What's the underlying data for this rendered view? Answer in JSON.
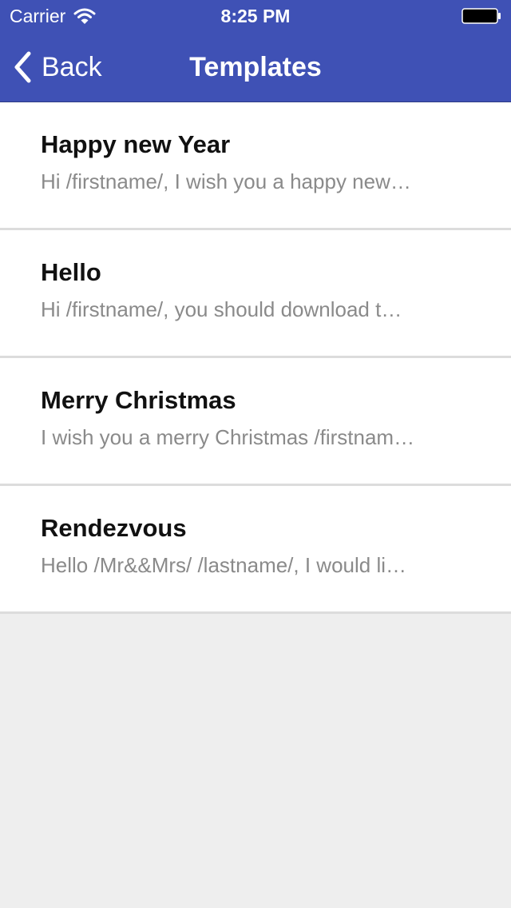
{
  "status_bar": {
    "carrier": "Carrier",
    "time": "8:25 PM",
    "wifi_icon": "wifi-icon",
    "battery_icon": "battery-icon"
  },
  "nav": {
    "back_label": "Back",
    "back_icon": "chevron-left-icon",
    "title": "Templates"
  },
  "colors": {
    "header_bg": "#3f51b5",
    "list_bg": "#ffffff",
    "page_bg": "#eeeeee",
    "title_text": "#111111",
    "preview_text": "#8a8a8a"
  },
  "templates": [
    {
      "title": "Happy new Year",
      "preview": "Hi /firstname/, I wish you a happy new…"
    },
    {
      "title": "Hello",
      "preview": "Hi /firstname/, you should download t…"
    },
    {
      "title": "Merry Christmas",
      "preview": "I wish you a merry Christmas /firstnam…"
    },
    {
      "title": "Rendezvous",
      "preview": "Hello /Mr&&Mrs/ /lastname/, I would li…"
    }
  ]
}
